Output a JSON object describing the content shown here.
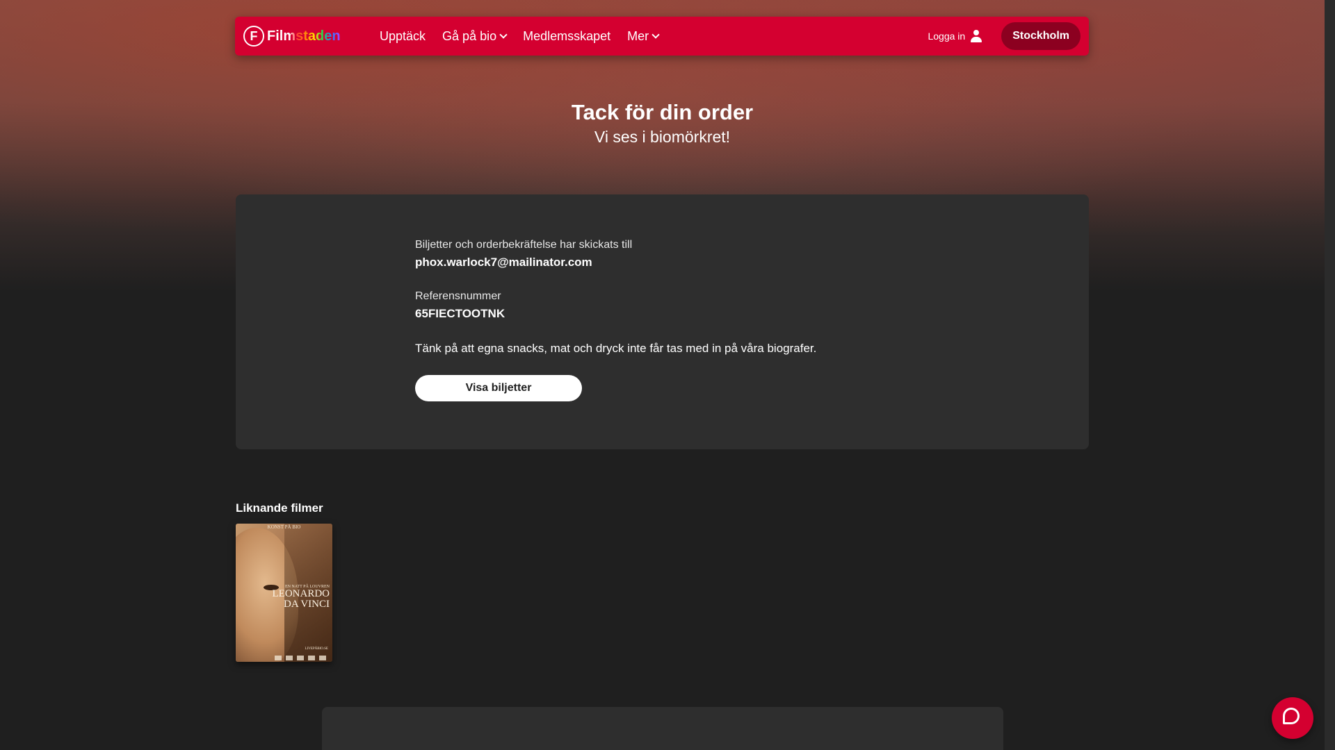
{
  "header": {
    "logo_text": "Filmstaden",
    "logo_letter": "F",
    "nav": [
      {
        "label": "Upptäck"
      },
      {
        "label": "Gå på bio"
      },
      {
        "label": "Medlemsskapet"
      },
      {
        "label": "Mer"
      }
    ],
    "login_label": "Logga in",
    "city_label": "Stockholm"
  },
  "hero": {
    "title": "Tack för din order",
    "subtitle": "Vi ses i biomörkret!"
  },
  "order": {
    "sent_to_label": "Biljetter och orderbekräftelse har skickats till",
    "email": "phox.warlock7@mailinator.com",
    "reference_label": "Referensnummer",
    "reference": "65FIECTOOTNK",
    "notice": "Tänk på att egna snacks, mat och dryck inte får tas med in på våra biografer.",
    "view_tickets_label": "Visa biljetter"
  },
  "similar": {
    "title": "Liknande filmer",
    "movies": [
      {
        "poster_top": "KONST PÅ BIO",
        "poster_sub": "EN NATT PÅ LOUVREN",
        "poster_name": "LEONARDO DA VINCI",
        "poster_foot": "LIVEPÅBIO.SE"
      }
    ]
  },
  "colors": {
    "brand_red": "#d40030",
    "city_button": "#8c0020",
    "card_bg": "#2e2e2e",
    "page_bg": "#1f1f1f"
  },
  "icons": {
    "user": "user-icon",
    "chevron": "chevron-down-icon",
    "chat": "chat-icon"
  }
}
